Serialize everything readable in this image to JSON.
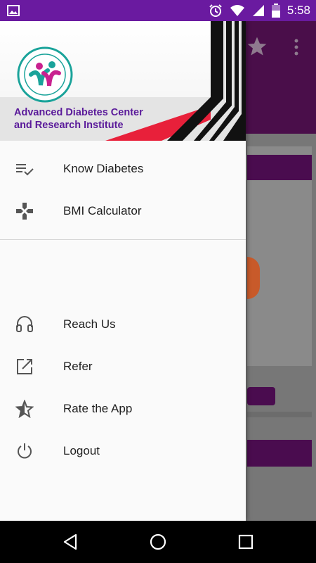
{
  "status_bar": {
    "time": "5:58",
    "left_icon": "image-icon",
    "right_icons": [
      "alarm-icon",
      "wifi-icon",
      "signal-icon",
      "battery-icon"
    ]
  },
  "drawer": {
    "header": {
      "org_name_line1": "Advanced Diabetes Center",
      "org_name_line2": "and Research Institute",
      "logo": "adcri-logo"
    },
    "menu_primary": [
      {
        "label": "Know Diabetes",
        "icon": "checklist-icon"
      },
      {
        "label": "BMI Calculator",
        "icon": "gamepad-icon"
      }
    ],
    "menu_secondary": [
      {
        "label": "Reach Us",
        "icon": "headset-icon"
      },
      {
        "label": "Refer",
        "icon": "share-icon"
      },
      {
        "label": "Rate the App",
        "icon": "star-half-icon"
      },
      {
        "label": "Logout",
        "icon": "power-icon"
      }
    ]
  },
  "colors": {
    "status_bar": "#6a1aa0",
    "brand_purple": "#5a1a9a",
    "toolbar_bg": "#4a0e4a",
    "accent_red": "#e8203a"
  },
  "nav_bar": [
    "back-icon",
    "home-icon",
    "recents-icon"
  ]
}
